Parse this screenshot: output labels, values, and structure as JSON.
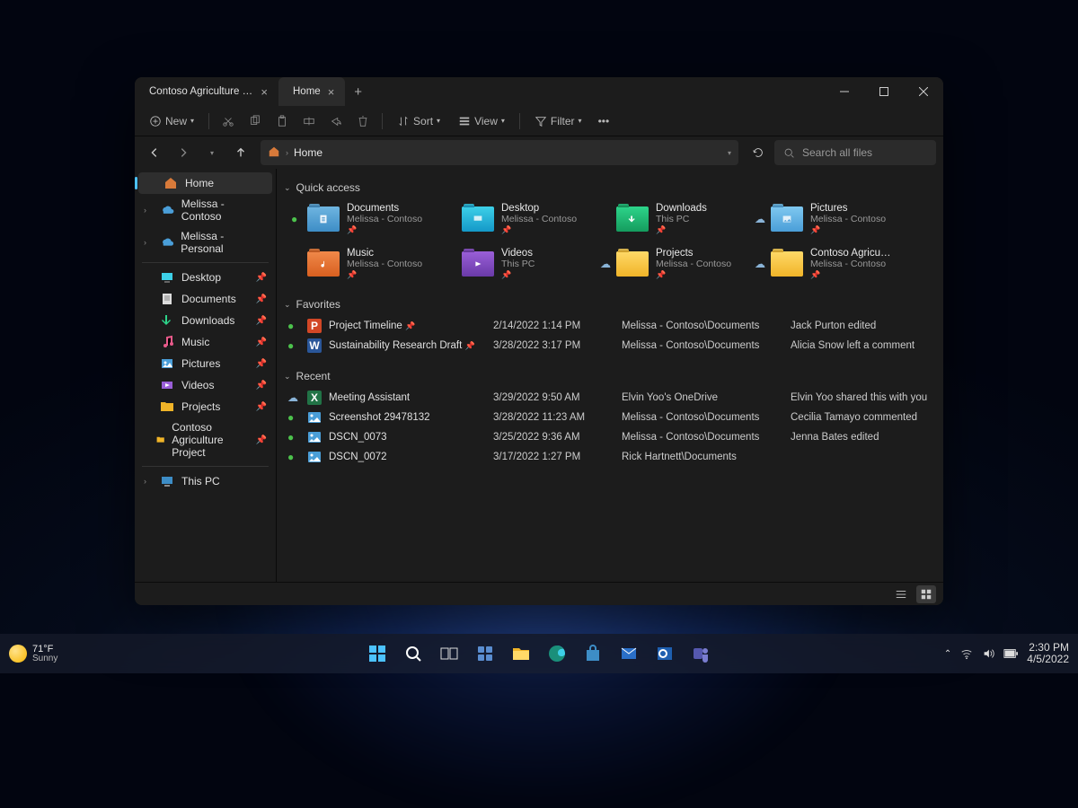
{
  "tabs": [
    {
      "title": "Contoso Agriculture Project",
      "active": false
    },
    {
      "title": "Home",
      "active": true
    }
  ],
  "toolbar": {
    "new": "New",
    "sort": "Sort",
    "view": "View",
    "filter": "Filter"
  },
  "address": {
    "root": "Home"
  },
  "search": {
    "placeholder": "Search all files"
  },
  "sidebar": {
    "top": [
      {
        "name": "Home",
        "active": true
      },
      {
        "name": "Melissa - Contoso",
        "expandable": true
      },
      {
        "name": "Melissa - Personal",
        "expandable": true
      }
    ],
    "pinned": [
      {
        "name": "Desktop"
      },
      {
        "name": "Documents"
      },
      {
        "name": "Downloads"
      },
      {
        "name": "Music"
      },
      {
        "name": "Pictures"
      },
      {
        "name": "Videos"
      },
      {
        "name": "Projects"
      },
      {
        "name": "Contoso Agriculture Project"
      }
    ],
    "thispc": "This PC"
  },
  "sections": {
    "quick": "Quick access",
    "favorites": "Favorites",
    "recent": "Recent"
  },
  "quick": [
    {
      "name": "Documents",
      "loc": "Melissa - Contoso",
      "color": "fblue",
      "status": "sync"
    },
    {
      "name": "Desktop",
      "loc": "Melissa - Contoso",
      "color": "fcyan",
      "status": ""
    },
    {
      "name": "Downloads",
      "loc": "This PC",
      "color": "fgreen",
      "status": ""
    },
    {
      "name": "Pictures",
      "loc": "Melissa - Contoso",
      "color": "fsky",
      "status": "cloud"
    },
    {
      "name": "Music",
      "loc": "Melissa - Contoso",
      "color": "forange",
      "status": ""
    },
    {
      "name": "Videos",
      "loc": "This PC",
      "color": "fpurple",
      "status": ""
    },
    {
      "name": "Projects",
      "loc": "Melissa - Contoso",
      "color": "fyellow",
      "status": "cloud"
    },
    {
      "name": "Contoso Agriculture Project",
      "loc": "Melissa - Contoso",
      "color": "fyellow",
      "status": "cloud"
    }
  ],
  "favorites": [
    {
      "name": "Project Timeline",
      "date": "2/14/2022 1:14 PM",
      "loc": "Melissa - Contoso\\Documents",
      "activity": "Jack Purton edited",
      "status": "sync",
      "icon": "ppt"
    },
    {
      "name": "Sustainability Research Draft",
      "date": "3/28/2022 3:17 PM",
      "loc": "Melissa - Contoso\\Documents",
      "activity": "Alicia Snow left a comment",
      "status": "sync",
      "icon": "word"
    }
  ],
  "recent": [
    {
      "name": "Meeting Assistant",
      "date": "3/29/2022 9:50 AM",
      "loc": "Elvin Yoo's OneDrive",
      "activity": "Elvin Yoo shared this with you",
      "status": "cloud",
      "icon": "excel"
    },
    {
      "name": "Screenshot 29478132",
      "date": "3/28/2022 11:23 AM",
      "loc": "Melissa - Contoso\\Documents",
      "activity": "Cecilia Tamayo commented",
      "status": "sync",
      "icon": "image"
    },
    {
      "name": "DSCN_0073",
      "date": "3/25/2022 9:36 AM",
      "loc": "Melissa - Contoso\\Documents",
      "activity": "Jenna Bates edited",
      "status": "sync",
      "icon": "image"
    },
    {
      "name": "DSCN_0072",
      "date": "3/17/2022 1:27 PM",
      "loc": "Rick Hartnett\\Documents",
      "activity": "",
      "status": "sync",
      "icon": "image"
    }
  ],
  "taskbar": {
    "temp": "71°F",
    "cond": "Sunny",
    "time": "2:30 PM",
    "date": "4/5/2022"
  }
}
